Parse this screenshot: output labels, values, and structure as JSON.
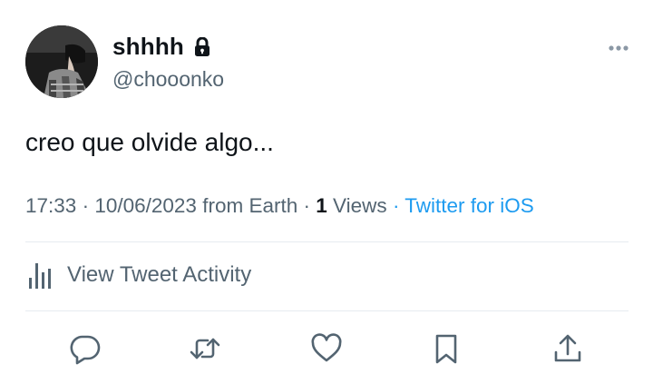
{
  "user": {
    "display_name": "shhhh",
    "handle": "@chooonko",
    "avatar_icon": "profile-photo",
    "protected_icon": "lock-icon"
  },
  "tweet": {
    "text": "creo que olvide algo...",
    "time": "17:33",
    "date": "10/06/2023",
    "location": "from Earth",
    "views_count": "1",
    "views_label": "Views",
    "source": "Twitter for iOS"
  },
  "activity": {
    "label": "View Tweet Activity",
    "icon": "bar-chart-icon"
  },
  "actions": [
    "reply-icon",
    "retweet-icon",
    "like-icon",
    "bookmark-icon",
    "share-icon"
  ],
  "colors": {
    "text": "#0f1419",
    "secondary": "#536471",
    "accent": "#1d9bf0",
    "divider": "#e6ecf0"
  }
}
